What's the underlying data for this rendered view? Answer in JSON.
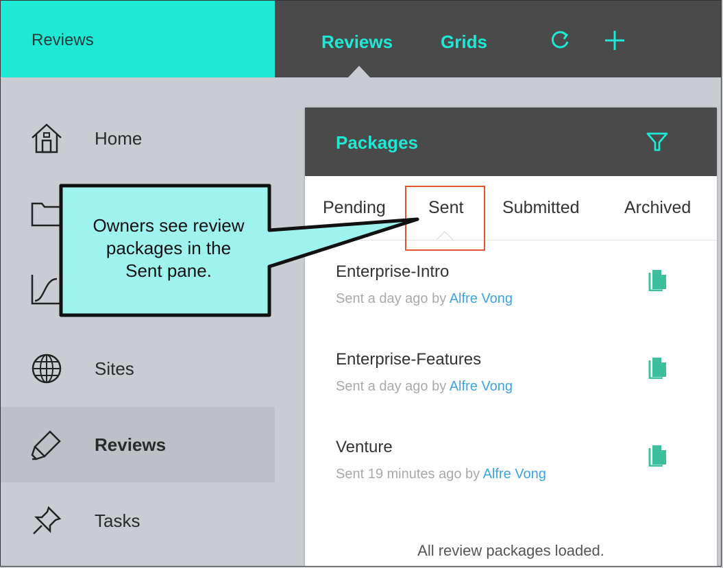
{
  "app": {
    "title": "Reviews"
  },
  "topnav": {
    "tabs": [
      "Reviews",
      "Grids"
    ],
    "active_tab": "Reviews",
    "icons": [
      "refresh-icon",
      "plus-icon"
    ]
  },
  "sidebar": {
    "items": [
      {
        "label": "Home",
        "icon": "home-icon",
        "active": false
      },
      {
        "label": "",
        "icon": "folder-icon",
        "active": false
      },
      {
        "label": "",
        "icon": "chart-icon",
        "active": false
      },
      {
        "label": "Sites",
        "icon": "globe-icon",
        "active": false
      },
      {
        "label": "Reviews",
        "icon": "highlighter-icon",
        "active": true
      },
      {
        "label": "Tasks",
        "icon": "pin-icon",
        "active": false
      }
    ]
  },
  "panel": {
    "title": "Packages",
    "filter_icon": "filter-icon",
    "tabs": [
      "Pending",
      "Sent",
      "Submitted",
      "Archived"
    ],
    "active_tab": "Sent",
    "packages": [
      {
        "name": "Enterprise-Intro",
        "meta": "Sent a day ago by ",
        "user": "Alfre Vong"
      },
      {
        "name": "Enterprise-Features",
        "meta": "Sent a day ago by ",
        "user": "Alfre Vong"
      },
      {
        "name": "Venture",
        "meta": "Sent 19 minutes ago by ",
        "user": "Alfre Vong"
      }
    ],
    "footer": "All review packages loaded."
  },
  "callout": {
    "lines": [
      "Owners see review",
      "packages in the",
      "Sent pane."
    ]
  },
  "colors": {
    "accent": "#1de9d4",
    "dark": "#4a4a4a",
    "sidebar_bg": "#c9ccd0",
    "link": "#3ba3e0",
    "doc_icon": "#3dbf9c",
    "callout_fill": "#9ff3ef",
    "highlight_border": "#e2552c"
  }
}
